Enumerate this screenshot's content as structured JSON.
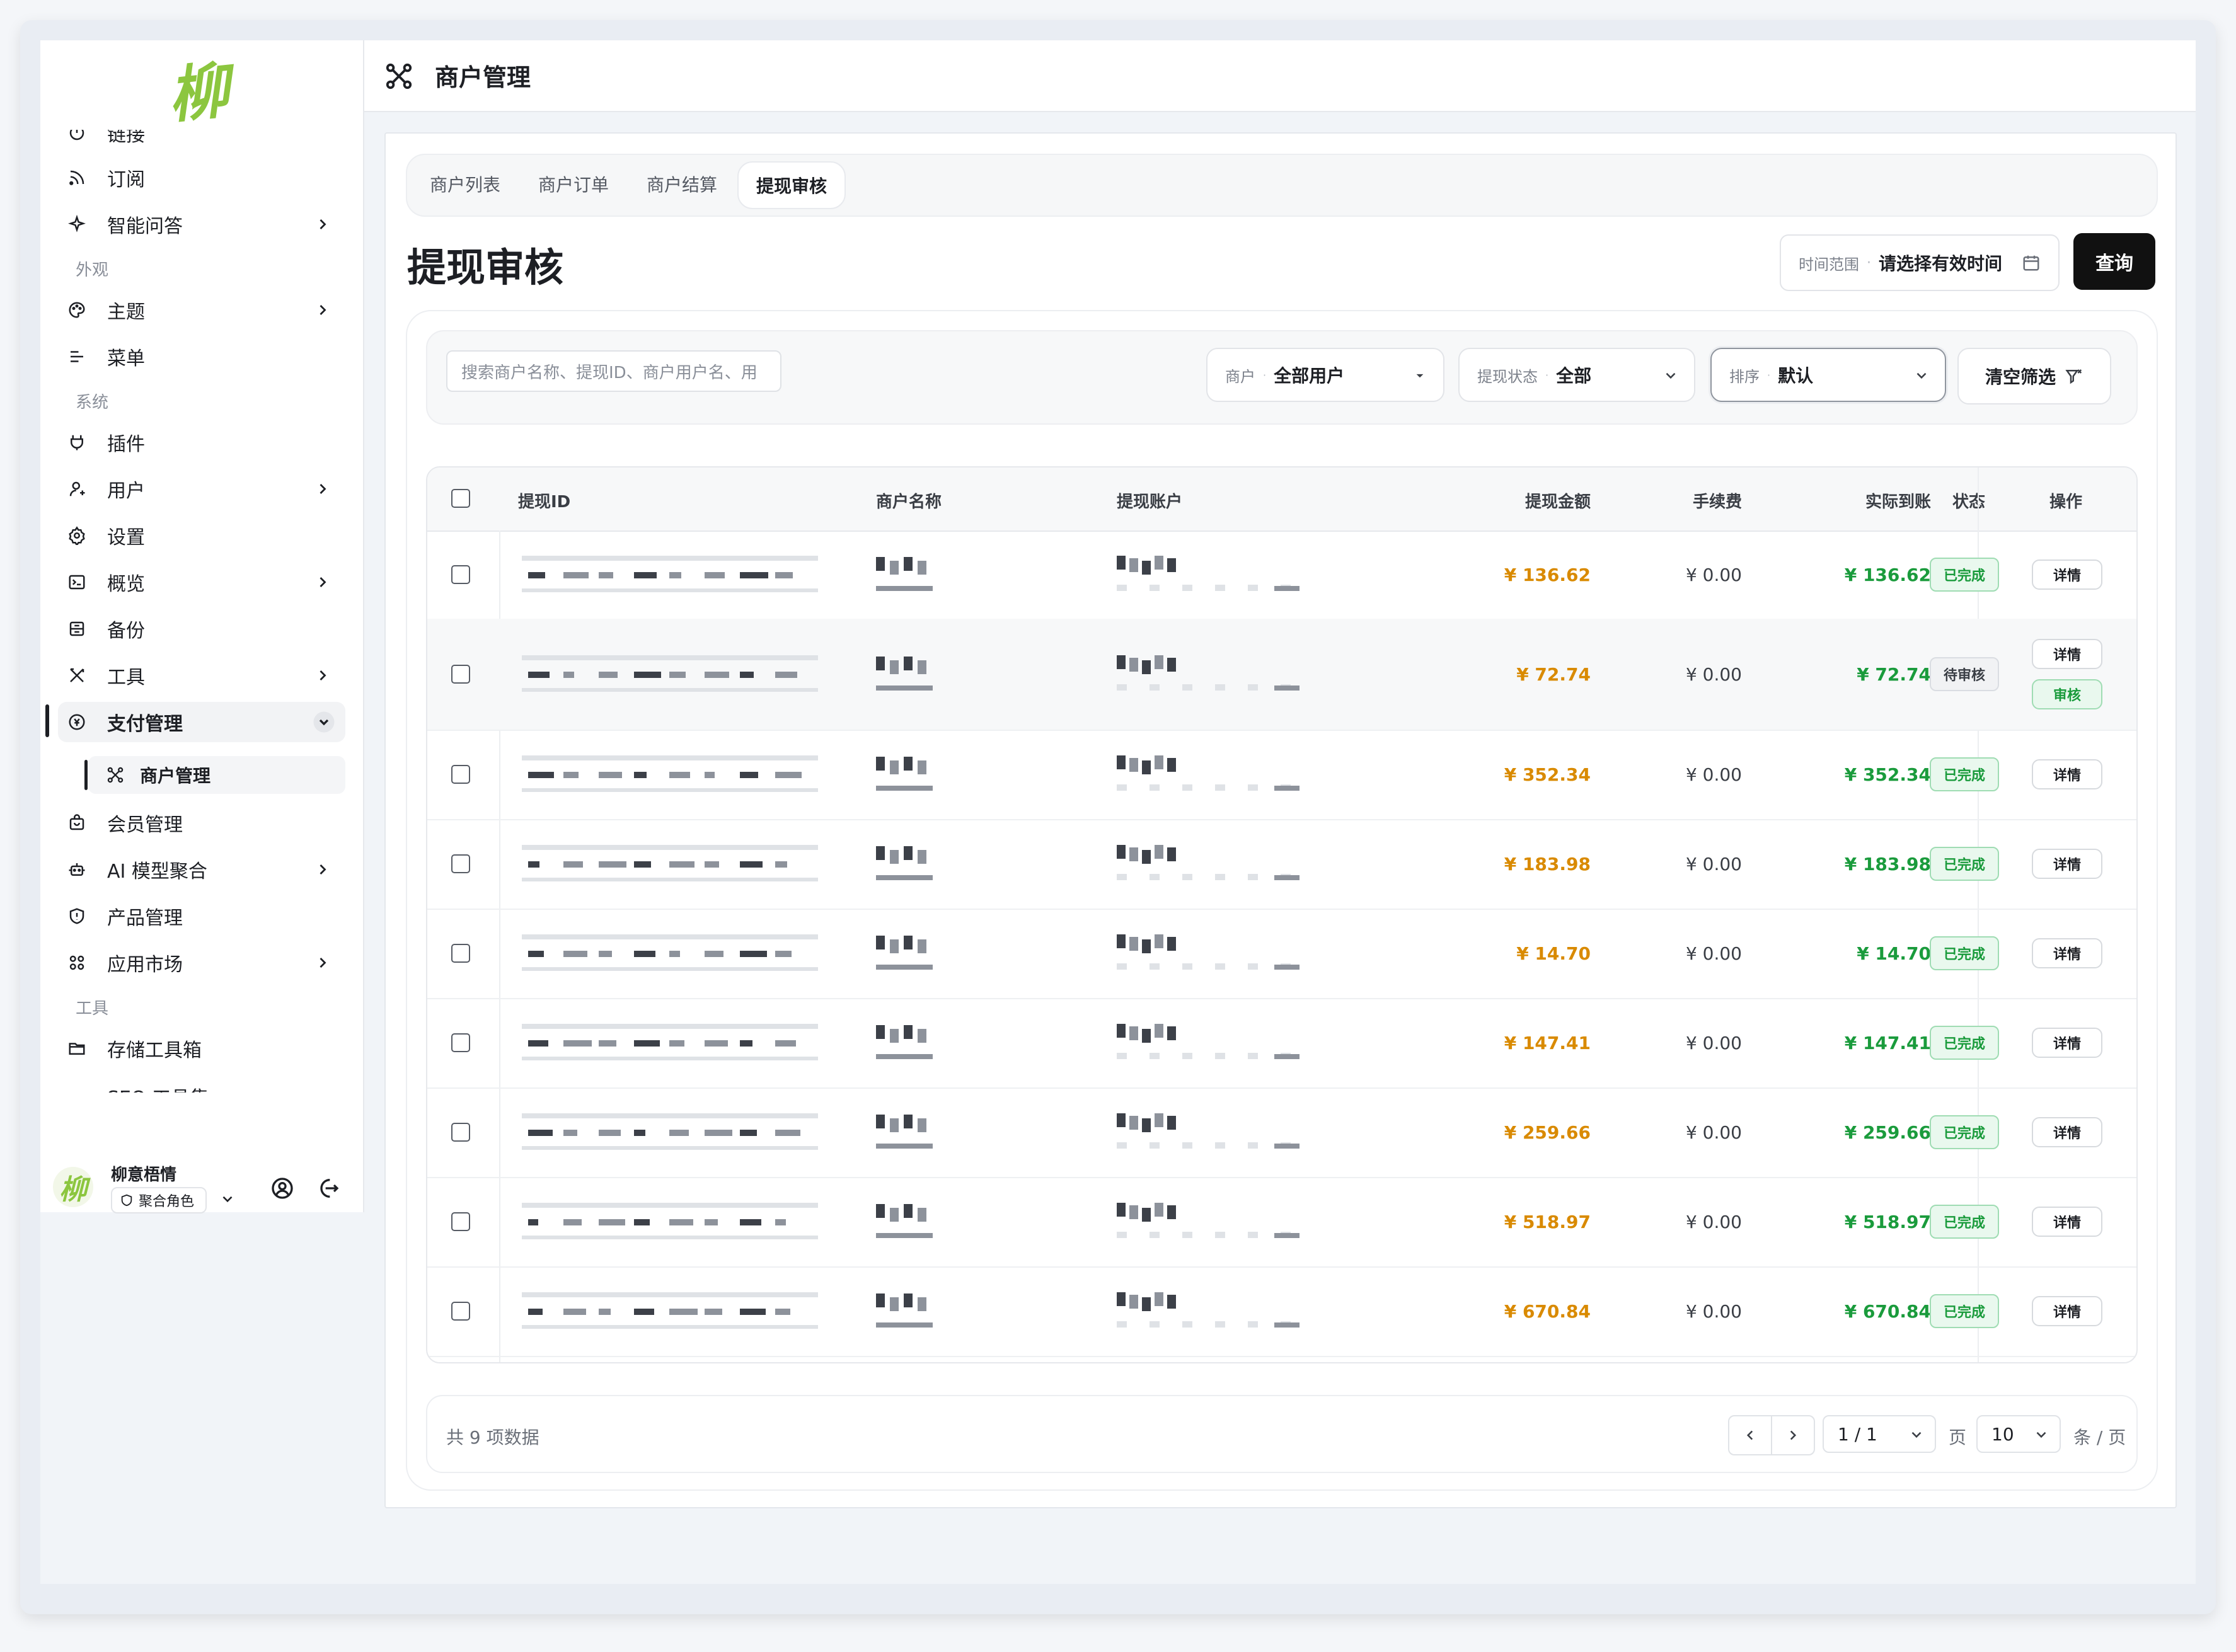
{
  "sidebar": {
    "logo_text": "柳",
    "items": [
      {
        "label": "链接"
      },
      {
        "label": "订阅"
      },
      {
        "label": "智能问答"
      },
      {
        "label": "主题"
      },
      {
        "label": "菜单"
      },
      {
        "label": "插件"
      },
      {
        "label": "用户"
      },
      {
        "label": "设置"
      },
      {
        "label": "概览"
      },
      {
        "label": "备份"
      },
      {
        "label": "工具"
      },
      {
        "label": "支付管理"
      },
      {
        "label": "商户管理"
      },
      {
        "label": "会员管理"
      },
      {
        "label": "AI 模型聚合"
      },
      {
        "label": "产品管理"
      },
      {
        "label": "应用市场"
      },
      {
        "label": "存储工具箱"
      },
      {
        "label": "SEO 工具集"
      }
    ],
    "sections": {
      "appearance": "外观",
      "system": "系统",
      "tools": "工具"
    },
    "user": {
      "name": "柳意梧情",
      "role": "聚合角色",
      "avatar_text": "柳"
    }
  },
  "header": {
    "title": "商户管理"
  },
  "tabs": [
    {
      "label": "商户列表"
    },
    {
      "label": "商户订单"
    },
    {
      "label": "商户结算"
    },
    {
      "label": "提现审核"
    }
  ],
  "page": {
    "title": "提现审核"
  },
  "date_filter": {
    "label": "时间范围",
    "value": "请选择有效时间"
  },
  "query_button": "查询",
  "filters": {
    "search_placeholder": "搜索商户名称、提现ID、商户用户名、用",
    "merchant": {
      "label": "商户",
      "value": "全部用户"
    },
    "status": {
      "label": "提现状态",
      "value": "全部"
    },
    "sort": {
      "label": "排序",
      "value": "默认"
    },
    "clear_label": "清空筛选"
  },
  "table": {
    "columns": [
      "提现ID",
      "商户名称",
      "提现账户",
      "提现金额",
      "手续费",
      "实际到账",
      "状态",
      "操作"
    ],
    "rows": [
      {
        "amount": "¥ 136.62",
        "fee": "¥ 0.00",
        "real": "¥ 136.62",
        "status": "已完成",
        "status_type": "done",
        "action": "详情"
      },
      {
        "amount": "¥ 72.74",
        "fee": "¥ 0.00",
        "real": "¥ 72.74",
        "status": "待审核",
        "status_type": "pending",
        "action": "详情",
        "action2": "审核"
      },
      {
        "amount": "¥ 352.34",
        "fee": "¥ 0.00",
        "real": "¥ 352.34",
        "status": "已完成",
        "status_type": "done",
        "action": "详情"
      },
      {
        "amount": "¥ 183.98",
        "fee": "¥ 0.00",
        "real": "¥ 183.98",
        "status": "已完成",
        "status_type": "done",
        "action": "详情"
      },
      {
        "amount": "¥ 14.70",
        "fee": "¥ 0.00",
        "real": "¥ 14.70",
        "status": "已完成",
        "status_type": "done",
        "action": "详情"
      },
      {
        "amount": "¥ 147.41",
        "fee": "¥ 0.00",
        "real": "¥ 147.41",
        "status": "已完成",
        "status_type": "done",
        "action": "详情"
      },
      {
        "amount": "¥ 259.66",
        "fee": "¥ 0.00",
        "real": "¥ 259.66",
        "status": "已完成",
        "status_type": "done",
        "action": "详情"
      },
      {
        "amount": "¥ 518.97",
        "fee": "¥ 0.00",
        "real": "¥ 518.97",
        "status": "已完成",
        "status_type": "done",
        "action": "详情"
      },
      {
        "amount": "¥ 670.84",
        "fee": "¥ 0.00",
        "real": "¥ 670.84",
        "status": "已完成",
        "status_type": "done",
        "action": "详情"
      }
    ]
  },
  "pagination": {
    "total": "共 9 项数据",
    "page": "1 / 1",
    "page_unit": "页",
    "page_size": "10",
    "size_unit": "条 / 页"
  },
  "colors": {
    "amount": "#d98a00",
    "real": "#1a9b3c",
    "accent": "#111111",
    "logo": "#8cc63f"
  }
}
